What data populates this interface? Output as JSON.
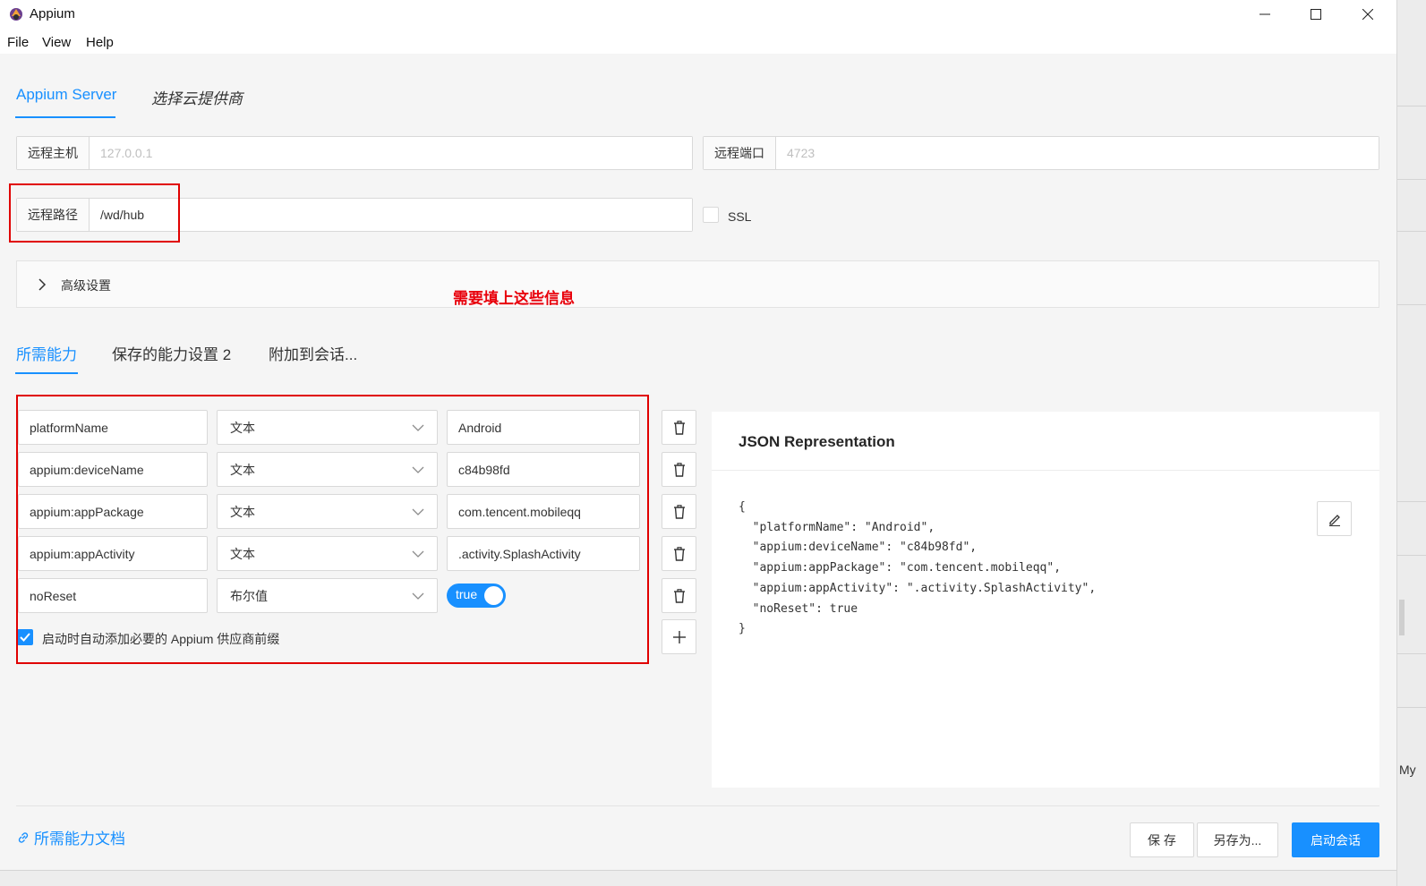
{
  "window": {
    "title": "Appium"
  },
  "menu": [
    "File",
    "View",
    "Help"
  ],
  "server_tabs": {
    "appium_server": "Appium Server",
    "cloud": "选择云提供商"
  },
  "server": {
    "host_label": "远程主机",
    "host_placeholder": "127.0.0.1",
    "port_label": "远程端口",
    "port_placeholder": "4723",
    "path_label": "远程路径",
    "path_value": "/wd/hub",
    "ssl_label": "SSL"
  },
  "advanced": {
    "label": "高级设置"
  },
  "annotation": {
    "text": "需要填上这些信息"
  },
  "cap_tabs": {
    "required": "所需能力",
    "saved": "保存的能力设置 2",
    "attach": "附加到会话..."
  },
  "capabilities": [
    {
      "name": "platformName",
      "type": "文本",
      "value": "Android"
    },
    {
      "name": "appium:deviceName",
      "type": "文本",
      "value": "c84b98fd"
    },
    {
      "name": "appium:appPackage",
      "type": "文本",
      "value": "com.tencent.mobileqq"
    },
    {
      "name": "appium:appActivity",
      "type": "文本",
      "value": ".activity.SplashActivity"
    },
    {
      "name": "noReset",
      "type": "布尔值",
      "value": "true"
    }
  ],
  "auto_prefix": {
    "label": "启动时自动添加必要的 Appium 供应商前缀",
    "checked": true
  },
  "json_panel": {
    "title": "JSON Representation",
    "code": "{\n  \"platformName\": \"Android\",\n  \"appium:deviceName\": \"c84b98fd\",\n  \"appium:appPackage\": \"com.tencent.mobileqq\",\n  \"appium:appActivity\": \".activity.SplashActivity\",\n  \"noReset\": true\n}"
  },
  "footer": {
    "docs_link": "所需能力文档",
    "save": "保 存",
    "save_as": "另存为...",
    "start_session": "启动会话"
  },
  "edge": {
    "text": "My"
  },
  "colors": {
    "accent": "#1890ff",
    "annotation_red": "#e00000"
  }
}
